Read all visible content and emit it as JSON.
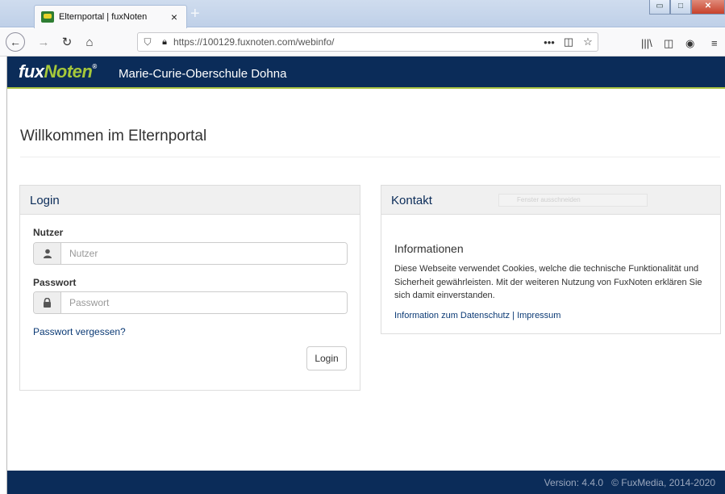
{
  "browser": {
    "tab_title": "Elternportal | fuxNoten",
    "tab_close": "×",
    "new_tab": "+",
    "url": "https://100129.fuxnoten.com/webinfo/",
    "more": "•••"
  },
  "header": {
    "logo_fux": "fux",
    "logo_noten": "Noten",
    "logo_reg": "®",
    "school_name": "Marie-Curie-Oberschule Dohna"
  },
  "page": {
    "title": "Willkommen im Elternportal"
  },
  "login": {
    "heading": "Login",
    "user_label": "Nutzer",
    "user_placeholder": "Nutzer",
    "password_label": "Passwort",
    "password_placeholder": "Passwort",
    "forgot_link": "Passwort vergessen?",
    "submit_label": "Login"
  },
  "contact": {
    "heading": "Kontakt",
    "overlay_text": "Fenster ausschneiden",
    "info_heading": "Informationen",
    "info_text": "Diese Webseite verwendet Cookies, welche die technische Funktionalität und Sicherheit gewährleisten. Mit der weiteren Nutzung von FuxNoten erklären Sie sich damit einverstanden.",
    "privacy_link": "Information zum Datenschutz",
    "separator": "|",
    "imprint_link": "Impressum"
  },
  "footer": {
    "version": "Version: 4.4.0",
    "copyright": "© FuxMedia, 2014-2020"
  },
  "colors": {
    "brand_navy": "#0b2c59",
    "brand_green": "#a6c83a",
    "link": "#0b3a75"
  }
}
